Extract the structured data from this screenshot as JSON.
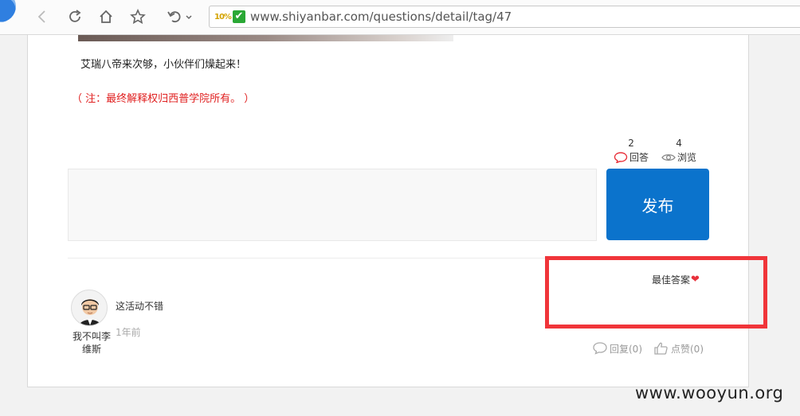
{
  "browser": {
    "url": "www.shiyanbar.com/questions/detail/tag/47",
    "secure_badge": "10%",
    "check_glyph": "✔"
  },
  "post": {
    "body_line": "艾瑞八帝来次够，小伙伴们燥起来！",
    "note": "（ 注：最终解释权归西普学院所有。 ）"
  },
  "stats": {
    "answers_count": "2",
    "answers_label": "回答",
    "views_count": "4",
    "views_label": "浏览"
  },
  "reply": {
    "publish_label": "发布"
  },
  "answer": {
    "best_label": "最佳答案",
    "username": "我不叫李维斯",
    "text": "这活动不错",
    "time": "1年前",
    "reply_label": "回复(0)",
    "like_label": "点赞(0)"
  },
  "watermark": "www.wooyun.org",
  "colors": {
    "accent_blue": "#0b73cc",
    "note_red": "#e02020",
    "highlight_red": "#f0353a",
    "heart_red": "#e8323c"
  },
  "icons": {
    "back": "back-arrow-icon",
    "refresh": "refresh-icon",
    "home": "home-icon",
    "favorite": "star-icon",
    "undo": "undo-icon",
    "answers": "speech-bubble-icon",
    "views": "eye-icon",
    "heart": "heart-icon",
    "reply": "comment-icon",
    "like": "thumbs-up-icon"
  }
}
